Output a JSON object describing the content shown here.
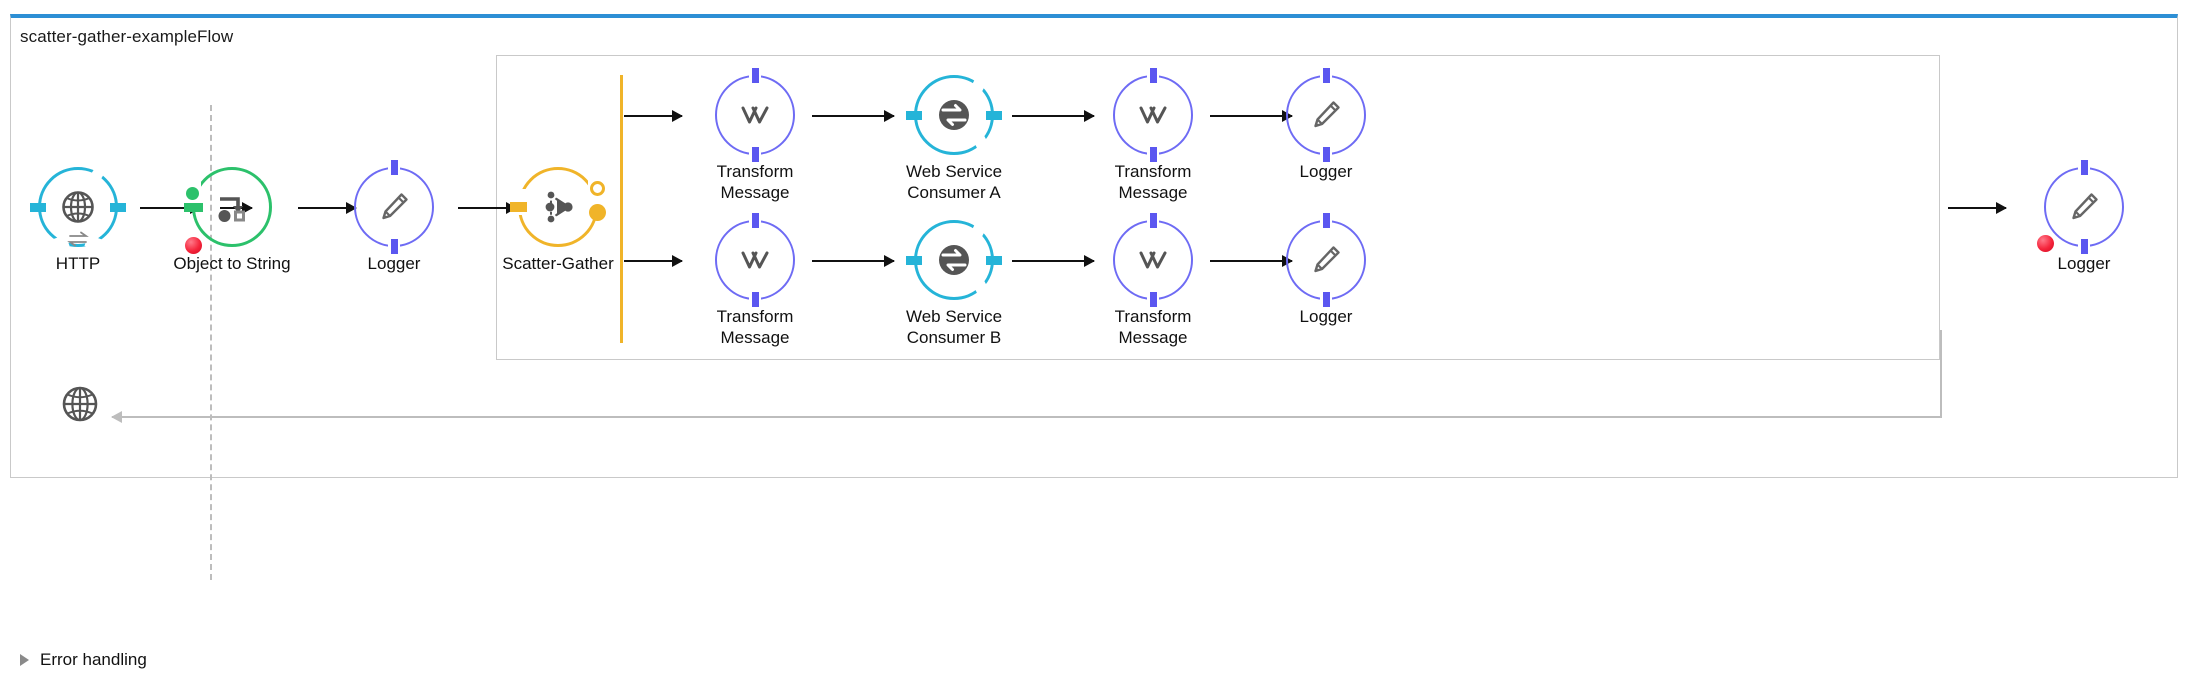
{
  "flow": {
    "title": "scatter-gather-exampleFlow",
    "accent_color": "#2d8fd5",
    "frame_border_color": "#c9c9c9"
  },
  "colors": {
    "cyan": "#25b4d8",
    "green": "#2cc16b",
    "purple": "#6e6bf4",
    "amber": "#f0b429",
    "breakpoint_red": "#f5243b",
    "connector": "#111111",
    "return_path": "#bdbdbd"
  },
  "source": {
    "name": "HTTP",
    "icon": "globe-icon",
    "ring_color": "#25b4d8"
  },
  "main_flow": [
    {
      "name": "Object to String",
      "icon": "object-to-string-icon",
      "ring_color": "#2cc16b",
      "breakpoint": true
    },
    {
      "name": "Logger",
      "icon": "pencil-icon",
      "ring_color": "#6e6bf4",
      "breakpoint": false
    }
  ],
  "scatter_gather": {
    "name": "Scatter-Gather",
    "icon": "scatter-gather-icon",
    "ring_color": "#f0b429",
    "route_bar_color": "#f0b429",
    "routes": [
      {
        "id": "route-a",
        "steps": [
          {
            "name": "Transform\nMessage",
            "label_line1": "Transform",
            "label_line2": "Message",
            "icon": "dataweave-icon",
            "ring_color": "#6e6bf4"
          },
          {
            "name": "Web Service\nConsumer A",
            "label_line1": "Web Service",
            "label_line2": "Consumer A",
            "icon": "web-service-consumer-icon",
            "ring_color": "#25b4d8"
          },
          {
            "name": "Transform\nMessage",
            "label_line1": "Transform",
            "label_line2": "Message",
            "icon": "dataweave-icon",
            "ring_color": "#6e6bf4"
          },
          {
            "name": "Logger",
            "label_line1": "Logger",
            "label_line2": "",
            "icon": "pencil-icon",
            "ring_color": "#6e6bf4"
          }
        ]
      },
      {
        "id": "route-b",
        "steps": [
          {
            "name": "Transform\nMessage",
            "label_line1": "Transform",
            "label_line2": "Message",
            "icon": "dataweave-icon",
            "ring_color": "#6e6bf4"
          },
          {
            "name": "Web Service\nConsumer B",
            "label_line1": "Web Service",
            "label_line2": "Consumer B",
            "icon": "web-service-consumer-icon",
            "ring_color": "#25b4d8"
          },
          {
            "name": "Transform\nMessage",
            "label_line1": "Transform",
            "label_line2": "Message",
            "icon": "dataweave-icon",
            "ring_color": "#6e6bf4"
          },
          {
            "name": "Logger",
            "label_line1": "Logger",
            "label_line2": "",
            "icon": "pencil-icon",
            "ring_color": "#6e6bf4"
          }
        ]
      }
    ]
  },
  "final_step": {
    "name": "Logger",
    "icon": "pencil-icon",
    "ring_color": "#6e6bf4",
    "breakpoint": true
  },
  "response": {
    "icon": "globe-icon",
    "name": "response-globe"
  },
  "error_handling": {
    "label": "Error handling",
    "expanded": false,
    "disclosure_icon": "triangle-right-icon"
  }
}
